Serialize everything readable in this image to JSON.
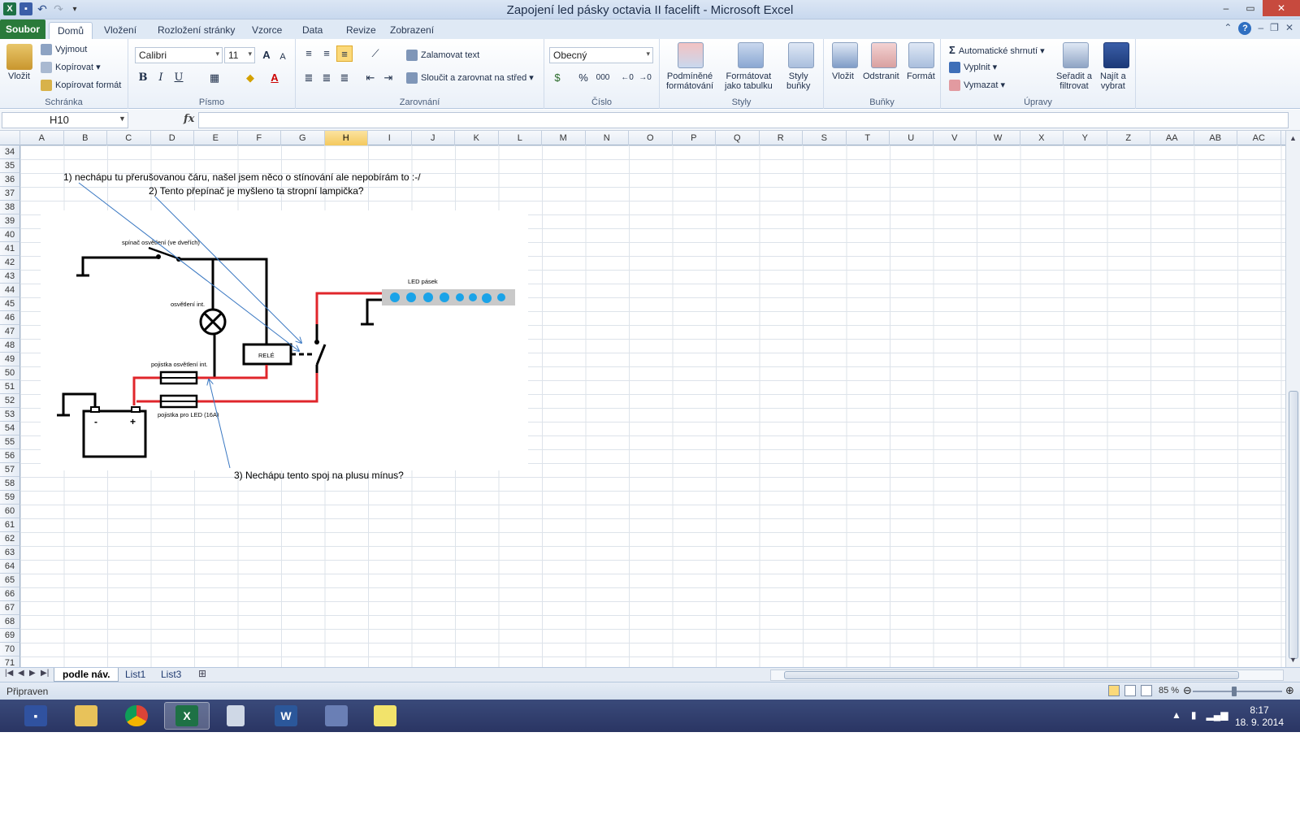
{
  "window": {
    "title": "Zapojení led pásky octavia II facelift  -  Microsoft Excel",
    "min": "–",
    "max": "▭",
    "close": "✕"
  },
  "tabs": {
    "file": "Soubor",
    "items": [
      "Domů",
      "Vložení",
      "Rozložení stránky",
      "Vzorce",
      "Data",
      "Revize",
      "Zobrazení"
    ]
  },
  "ribbon": {
    "clipboard": {
      "label": "Schránka",
      "paste": "Vložit",
      "cut": "Vyjmout",
      "copy": "Kopírovat",
      "painter": "Kopírovat formát"
    },
    "font": {
      "label": "Písmo",
      "name": "Calibri",
      "size": "11",
      "bold": "B",
      "italic": "I",
      "underline": "U",
      "grow": "A",
      "shrink": "A",
      "color": "A"
    },
    "alignment": {
      "label": "Zarovnání",
      "wrap": "Zalamovat text",
      "merge": "Sloučit a zarovnat na střed"
    },
    "number": {
      "label": "Číslo",
      "format": "Obecný",
      "percent": "%",
      "thousands": "000"
    },
    "styles": {
      "label": "Styly",
      "cond1": "Podmíněné",
      "cond2": "formátování",
      "table1": "Formátovat",
      "table2": "jako tabulku",
      "cell1": "Styly",
      "cell2": "buňky"
    },
    "cells": {
      "label": "Buňky",
      "insert": "Vložit",
      "delete": "Odstranit",
      "format": "Formát"
    },
    "editing": {
      "label": "Úpravy",
      "autosum": "Automatické shrnutí",
      "fill": "Vyplnit",
      "clear": "Vymazat",
      "sort1": "Seřadit a",
      "sort2": "filtrovat",
      "find1": "Najít a",
      "find2": "vybrat"
    }
  },
  "formula_bar": {
    "name_box": "H10",
    "fx": "fx",
    "value": ""
  },
  "columns": [
    "A",
    "B",
    "C",
    "D",
    "E",
    "F",
    "G",
    "H",
    "I",
    "J",
    "K",
    "L",
    "M",
    "N",
    "O",
    "P",
    "Q",
    "R",
    "S",
    "T",
    "U",
    "V",
    "W",
    "X",
    "Y",
    "Z",
    "AA",
    "AB",
    "AC"
  ],
  "selected_column": "H",
  "rows": [
    "34",
    "35",
    "36",
    "37",
    "38",
    "39",
    "40",
    "41",
    "42",
    "43",
    "44",
    "45",
    "46",
    "47",
    "48",
    "49",
    "50",
    "51",
    "52",
    "53",
    "54",
    "55",
    "56",
    "57",
    "58",
    "59",
    "60",
    "61",
    "62",
    "63",
    "64",
    "65",
    "66",
    "67",
    "68",
    "69",
    "70",
    "71"
  ],
  "cells": {
    "note1": "1) nechápu tu přerušovanou čáru, našel jsem něco o stínování ale nepobírám to :-/",
    "note2": "2) Tento přepínač je myšleno ta stropní lampička?",
    "note3": "3) Nechápu tento spoj na plusu mínus?"
  },
  "diagram": {
    "switch_label": "spínač osvětlení (ve dveřích)",
    "lamp_label": "osvětlení int.",
    "relay_label": "RELÉ",
    "fuse1_label": "pojistka osvětlení int.",
    "fuse2_label": "pojistka pro LED (16A)",
    "led_label": "LED pásek",
    "battery_minus": "-",
    "battery_plus": "+",
    "colors": {
      "wire": "#000000",
      "power": "#e0262b",
      "led_dot": "#1aa3e8",
      "led_strip": "#c9c9c9",
      "arrow": "#3a78c2"
    }
  },
  "sheets": {
    "tabs": [
      "podle náv.",
      "List1",
      "List3"
    ],
    "active": "podle náv."
  },
  "status": {
    "ready": "Připraven",
    "zoom": "85 %"
  },
  "taskbar": {
    "time": "8:17",
    "date": "18. 9. 2014"
  }
}
